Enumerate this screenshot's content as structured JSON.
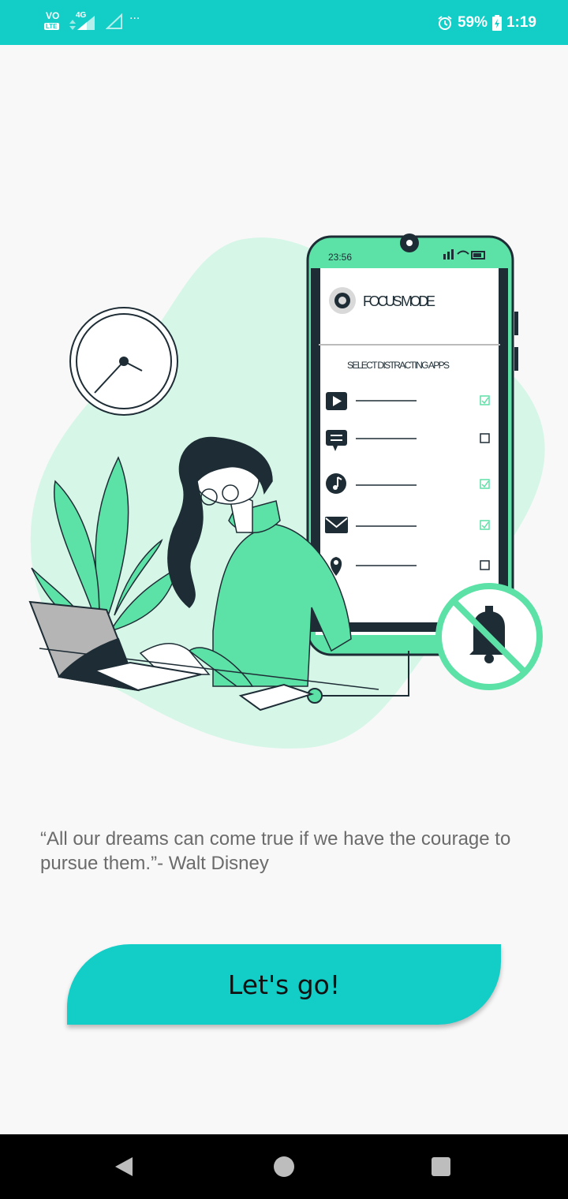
{
  "status_bar": {
    "volte_label": "VO",
    "lte_label": "LTE",
    "network_label": "4G",
    "more_label": "···",
    "battery_percent": "59%",
    "time": "1:19",
    "background_color": "#13cdc7"
  },
  "illustration": {
    "phone_time": "23:56",
    "app_title": "FOCUS MODE",
    "section_label": "SELECT DISTRACTING APPS",
    "apps": [
      {
        "icon": "play-icon",
        "checked": true
      },
      {
        "icon": "message-icon",
        "checked": false
      },
      {
        "icon": "music-icon",
        "checked": true
      },
      {
        "icon": "mail-icon",
        "checked": true
      },
      {
        "icon": "location-pin-icon",
        "checked": false
      }
    ],
    "accent_color": "#5ce1a6",
    "dark_color": "#1e2d35"
  },
  "quote": {
    "text": "“All our dreams can come true if we have the courage to pursue them.”- Walt Disney"
  },
  "cta": {
    "label": "Let's go!",
    "color": "#13cdc7"
  },
  "nav": {
    "back": "back-icon",
    "home": "home-icon",
    "recents": "recents-icon"
  }
}
